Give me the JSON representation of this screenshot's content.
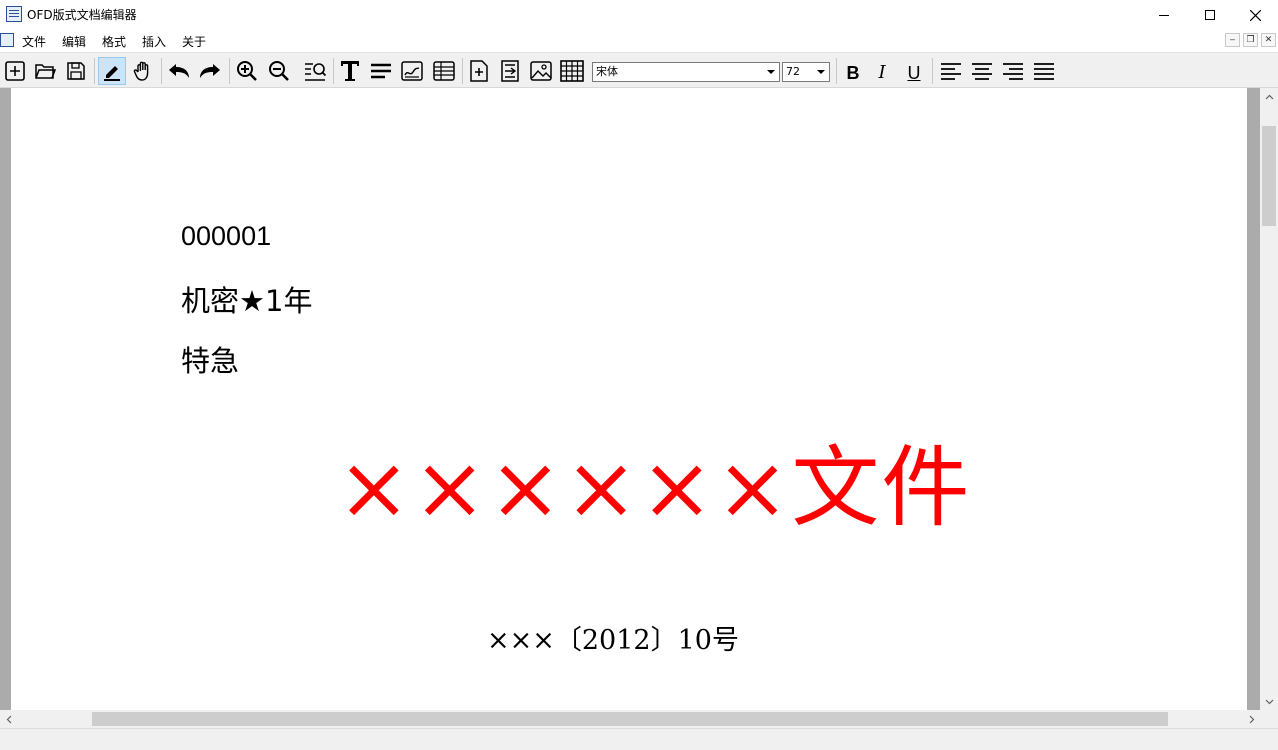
{
  "window": {
    "title": "OFD版式文档编辑器"
  },
  "menu": {
    "items": [
      "文件",
      "编辑",
      "格式",
      "插入",
      "关于"
    ]
  },
  "toolbar": {
    "font_name": "宋体",
    "font_size": "72",
    "bold_label": "B",
    "italic_label": "I",
    "underline_label": "U",
    "active_tool": "edit-pen"
  },
  "document": {
    "serial_number": "000001",
    "secret_level": "机密★1年",
    "urgency": "特急",
    "title": "××××××文件",
    "doc_number": "×××〔2012〕10号",
    "title_color": "#ff0000"
  }
}
